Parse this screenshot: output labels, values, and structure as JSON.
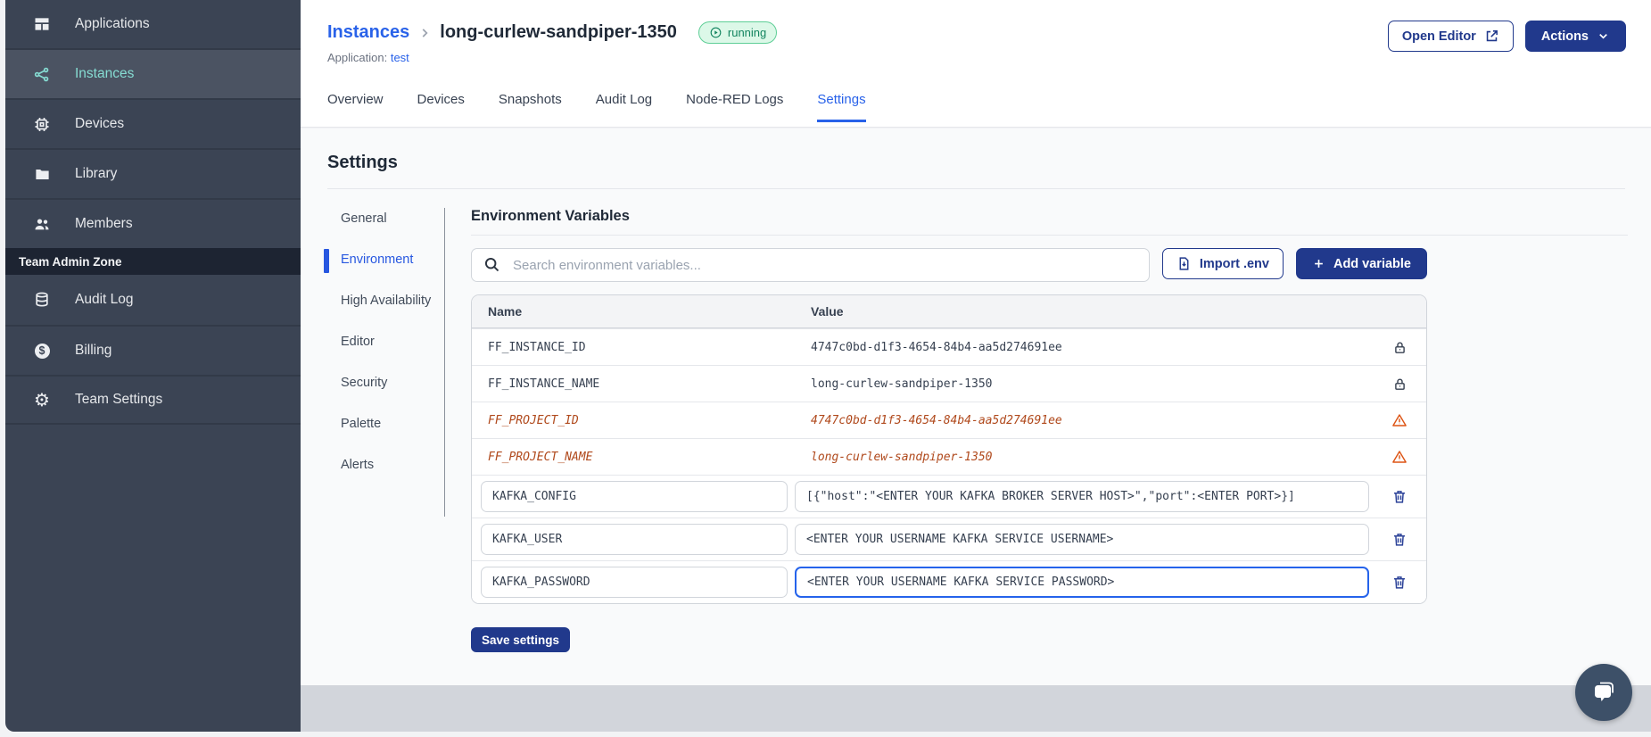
{
  "colors": {
    "sidebar_bg": "#3b4454",
    "sidebar_active_bg": "#4b5362",
    "sidebar_active_text": "#86ddd3",
    "admin_zone_bg": "#1d2432",
    "primary_navy": "#21398c",
    "link_blue": "#2962e9",
    "status_text": "#12845f",
    "status_bg": "#dcf8e8",
    "status_border": "#5ece96",
    "deprecated_orange": "#b0491c",
    "warning_orange": "#dd5414",
    "content_bg": "#f9fafb",
    "footer_band": "#d2d5db",
    "chat_bubble_bg": "#3d5068"
  },
  "sidebar": {
    "items": [
      {
        "label": "Applications",
        "icon": "applications-icon"
      },
      {
        "label": "Instances",
        "icon": "instances-icon",
        "active": true
      },
      {
        "label": "Devices",
        "icon": "devices-icon"
      },
      {
        "label": "Library",
        "icon": "library-icon"
      },
      {
        "label": "Members",
        "icon": "members-icon"
      }
    ],
    "section_label": "Team Admin Zone",
    "admin_items": [
      {
        "label": "Audit Log",
        "icon": "audit-log-icon"
      },
      {
        "label": "Billing",
        "icon": "billing-icon"
      },
      {
        "label": "Team Settings",
        "icon": "team-settings-icon"
      }
    ]
  },
  "header": {
    "breadcrumb_parent": "Instances",
    "instance_name": "long-curlew-sandpiper-1350",
    "status": "running",
    "application_label": "Application:",
    "application_name": "test",
    "open_editor_label": "Open Editor",
    "actions_label": "Actions"
  },
  "tabs": {
    "items": [
      "Overview",
      "Devices",
      "Snapshots",
      "Audit Log",
      "Node-RED Logs",
      "Settings"
    ],
    "active": "Settings"
  },
  "settings": {
    "title": "Settings",
    "nav": [
      "General",
      "Environment",
      "High Availability",
      "Editor",
      "Security",
      "Palette",
      "Alerts"
    ],
    "nav_active": "Environment",
    "section_title": "Environment Variables",
    "search_placeholder": "Search environment variables...",
    "import_label": "Import .env",
    "add_label": "Add variable",
    "table": {
      "columns": {
        "name": "Name",
        "value": "Value"
      },
      "rows": [
        {
          "name": "FF_INSTANCE_ID",
          "value": "4747c0bd-d1f3-4654-84b4-aa5d274691ee",
          "type": "locked"
        },
        {
          "name": "FF_INSTANCE_NAME",
          "value": "long-curlew-sandpiper-1350",
          "type": "locked"
        },
        {
          "name": "FF_PROJECT_ID",
          "value": "4747c0bd-d1f3-4654-84b4-aa5d274691ee",
          "type": "deprecated"
        },
        {
          "name": "FF_PROJECT_NAME",
          "value": "long-curlew-sandpiper-1350",
          "type": "deprecated"
        },
        {
          "name": "KAFKA_CONFIG",
          "value": "[{\"host\":\"<ENTER YOUR KAFKA BROKER SERVER HOST>\",\"port\":<ENTER PORT>}]",
          "type": "editable"
        },
        {
          "name": "KAFKA_USER",
          "value": "<ENTER YOUR USERNAME KAFKA SERVICE USERNAME>",
          "type": "editable"
        },
        {
          "name": "KAFKA_PASSWORD",
          "value": "<ENTER YOUR USERNAME KAFKA SERVICE PASSWORD>",
          "type": "editable",
          "focused": true
        }
      ]
    },
    "save_label": "Save settings"
  }
}
